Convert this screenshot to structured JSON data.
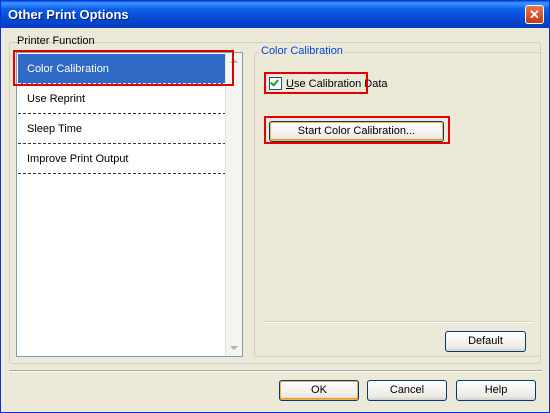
{
  "window": {
    "title": "Other Print Options",
    "close_glyph": "✕"
  },
  "printer_function": {
    "label": "Printer Function",
    "items": [
      {
        "label": "Color Calibration"
      },
      {
        "label": "Use Reprint"
      },
      {
        "label": "Sleep Time"
      },
      {
        "label": "Improve Print Output"
      }
    ],
    "selected_index": 0
  },
  "color_calibration": {
    "group_label": "Color Calibration",
    "checkbox_access_key": "U",
    "checkbox_label_rest": "se Calibration Data",
    "checkbox_checked": true,
    "start_button": "Start Color Calibration...",
    "default_button": "Default"
  },
  "footer": {
    "ok": "OK",
    "cancel": "Cancel",
    "help": "Help"
  },
  "colors": {
    "titlebar": "#0a5fe8",
    "selection": "#316ac5",
    "highlight_box": "#e00000",
    "group_label": "#0046d5"
  }
}
